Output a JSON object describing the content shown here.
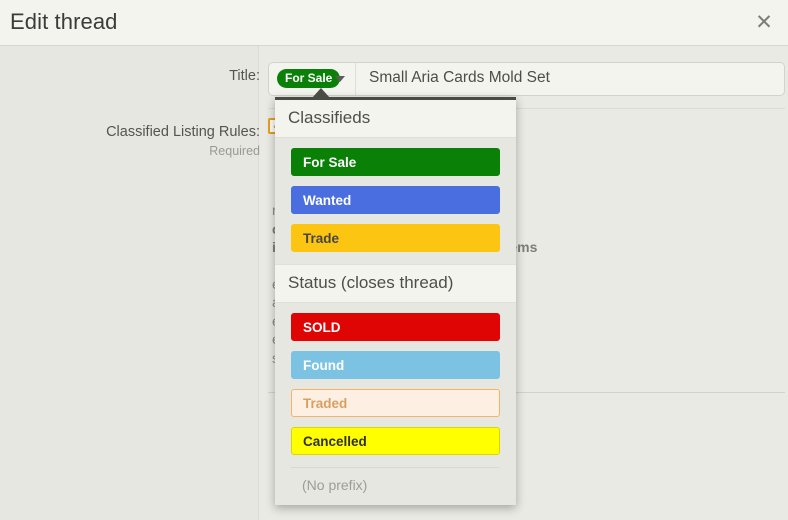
{
  "header": {
    "title": "Edit thread",
    "close_icon": "close-icon"
  },
  "form": {
    "title_row": {
      "label": "Title:",
      "prefix_badge": "For Sale",
      "caret_icon": "chevron-down-icon",
      "value": "Small Aria Cards Mold Set"
    },
    "rules_row": {
      "label": "Classified Listing Rules:",
      "sublabel": "Required",
      "checkbox_icon": "checkbox-checked-icon",
      "lines": [
        "rum. Use the Auction forum.",
        "ce.",
        "ice unless stated \"Not for sale\" or items",
        "et\" type ads.",
        " are permitted.",
        "er day.",
        "es.",
        "se of leaving feedback."
      ]
    }
  },
  "prefix_menu": {
    "sections": [
      {
        "heading": "Classifieds",
        "items": [
          {
            "label": "For Sale",
            "bg": "#0a8006",
            "fg": "#ffffff",
            "border": "#0a8006"
          },
          {
            "label": "Wanted",
            "bg": "#4a6ee0",
            "fg": "#ffffff",
            "border": "#4a6ee0"
          },
          {
            "label": "Trade",
            "bg": "#fcc511",
            "fg": "#46463f",
            "border": "#fcc511"
          }
        ]
      },
      {
        "heading": "Status (closes thread)",
        "items": [
          {
            "label": "SOLD",
            "bg": "#e00505",
            "fg": "#ffffff",
            "border": "#e00505"
          },
          {
            "label": "Found",
            "bg": "#7cc2e2",
            "fg": "#ffffff",
            "border": "#7cc2e2"
          },
          {
            "label": "Traded",
            "bg": "#fdf0e2",
            "fg": "#d6a063",
            "border": "#f6b368"
          },
          {
            "label": "Cancelled",
            "bg": "#ffff00",
            "fg": "#2f2f2b",
            "border": "#d8d800"
          }
        ]
      }
    ],
    "no_prefix_label": "(No prefix)"
  },
  "colors": {
    "page_bg": "#e7e7e1",
    "header_bg": "#f4f4ef",
    "accent_green": "#0a8006",
    "accent_orange": "#eb9c1f"
  }
}
